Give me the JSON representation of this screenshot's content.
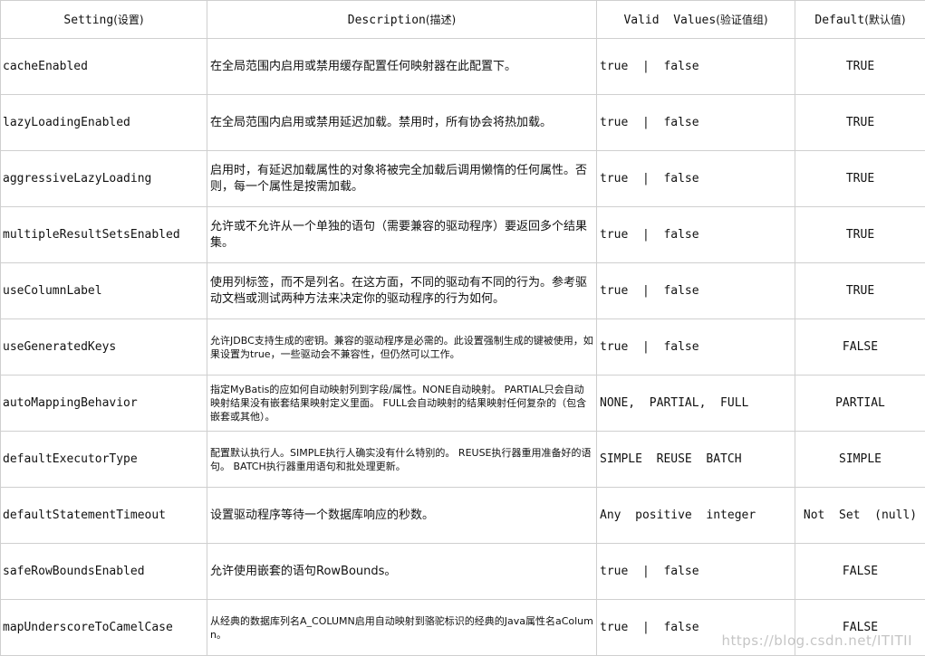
{
  "table": {
    "headers": {
      "setting": {
        "en": "Setting",
        "cn": "(设置)"
      },
      "description": {
        "en": "Description",
        "cn": "(描述)"
      },
      "valid": {
        "en": "Valid  Values",
        "cn": "(验证值组)"
      },
      "default": {
        "en": "Default",
        "cn": "(默认值)"
      }
    },
    "rows": [
      {
        "setting": "cacheEnabled",
        "description": "在全局范围内启用或禁用缓存配置任何映射器在此配置下。",
        "valid": "true  |  false",
        "default": "TRUE"
      },
      {
        "setting": "lazyLoadingEnabled",
        "description": "在全局范围内启用或禁用延迟加载。禁用时，所有协会将热加载。",
        "valid": "true  |  false",
        "default": "TRUE"
      },
      {
        "setting": "aggressiveLazyLoading",
        "description": "启用时，有延迟加载属性的对象将被完全加载后调用懒惰的任何属性。否则，每一个属性是按需加载。",
        "valid": "true  |  false",
        "default": "TRUE"
      },
      {
        "setting": "multipleResultSetsEnabled",
        "description": "允许或不允许从一个单独的语句（需要兼容的驱动程序）要返回多个结果集。",
        "valid": "true  |  false",
        "default": "TRUE"
      },
      {
        "setting": "useColumnLabel",
        "description": "使用列标签，而不是列名。在这方面，不同的驱动有不同的行为。参考驱动文档或测试两种方法来决定你的驱动程序的行为如何。",
        "valid": "true  |  false",
        "default": "TRUE"
      },
      {
        "setting": "useGeneratedKeys",
        "description": "允许JDBC支持生成的密钥。兼容的驱动程序是必需的。此设置强制生成的键被使用，如果设置为true，一些驱动会不兼容性，但仍然可以工作。",
        "valid": "true  |  false",
        "default": "FALSE"
      },
      {
        "setting": "autoMappingBehavior",
        "description": "指定MyBatis的应如何自动映射列到字段/属性。NONE自动映射。 PARTIAL只会自动映射结果没有嵌套结果映射定义里面。 FULL会自动映射的结果映射任何复杂的（包含嵌套或其他）。",
        "valid": "NONE,  PARTIAL,  FULL",
        "default": "PARTIAL"
      },
      {
        "setting": "defaultExecutorType",
        "description": "配置默认执行人。SIMPLE执行人确实没有什么特别的。 REUSE执行器重用准备好的语句。 BATCH执行器重用语句和批处理更新。",
        "valid": "SIMPLE  REUSE  BATCH",
        "default": "SIMPLE"
      },
      {
        "setting": "defaultStatementTimeout",
        "description": "设置驱动程序等待一个数据库响应的秒数。",
        "valid": "Any  positive  integer",
        "default": "Not  Set  (null)"
      },
      {
        "setting": "safeRowBoundsEnabled",
        "description": "允许使用嵌套的语句RowBounds。",
        "valid": "true  |  false",
        "default": "FALSE"
      },
      {
        "setting": "mapUnderscoreToCamelCase",
        "description": "从经典的数据库列名A_COLUMN启用自动映射到骆驼标识的经典的Java属性名aColumn。",
        "valid": "true  |  false",
        "default": "FALSE"
      }
    ]
  },
  "watermark": "https://blog.csdn.net/ITITII"
}
